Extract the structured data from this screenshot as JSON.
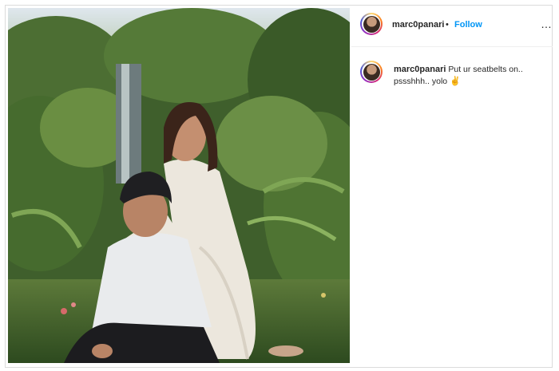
{
  "post": {
    "username": "marc0panari",
    "separator": "•",
    "follow_label": "Follow",
    "more_icon": "more-options-icon"
  },
  "caption": {
    "username": "marc0panari",
    "text": "Put ur seatbelts on.. pssshhh.. yolo",
    "emoji": "✌"
  },
  "photo": {
    "subject": "couple-photo-garden"
  }
}
